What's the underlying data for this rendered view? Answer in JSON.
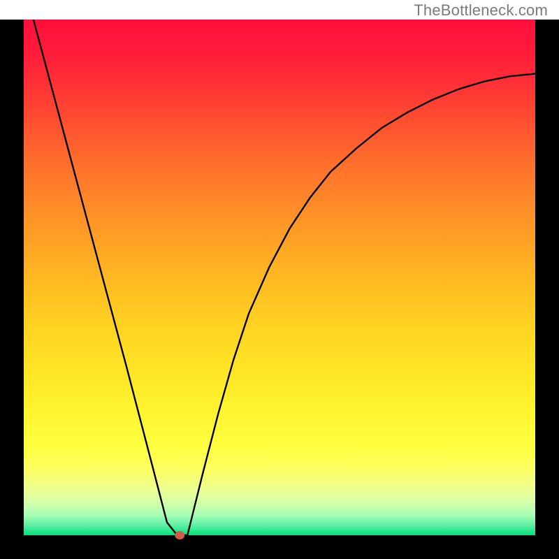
{
  "attribution": "TheBottleneck.com",
  "chart_data": {
    "type": "line",
    "title": "",
    "xlabel": "",
    "ylabel": "",
    "xlim": [
      0,
      1
    ],
    "ylim": [
      0,
      1
    ],
    "x": [
      0.0,
      0.05,
      0.1,
      0.15,
      0.2,
      0.25,
      0.28,
      0.3,
      0.31,
      0.32,
      0.33,
      0.35,
      0.38,
      0.41,
      0.44,
      0.48,
      0.52,
      0.56,
      0.6,
      0.65,
      0.7,
      0.75,
      0.8,
      0.85,
      0.9,
      0.95,
      1.0
    ],
    "values": [
      1.07,
      0.885,
      0.7,
      0.515,
      0.33,
      0.14,
      0.025,
      0.0,
      0.0,
      0.0,
      0.04,
      0.12,
      0.235,
      0.34,
      0.43,
      0.52,
      0.595,
      0.655,
      0.705,
      0.75,
      0.79,
      0.82,
      0.845,
      0.865,
      0.88,
      0.89,
      0.895
    ],
    "marker": {
      "x": 0.305,
      "y": 0.0
    },
    "background_gradient": {
      "stops": [
        {
          "offset": 0.0,
          "color": "#ff0e3c"
        },
        {
          "offset": 0.06,
          "color": "#ff1b3a"
        },
        {
          "offset": 0.12,
          "color": "#ff2f36"
        },
        {
          "offset": 0.2,
          "color": "#ff5030"
        },
        {
          "offset": 0.28,
          "color": "#ff6f2c"
        },
        {
          "offset": 0.36,
          "color": "#ff8b28"
        },
        {
          "offset": 0.44,
          "color": "#ffa524"
        },
        {
          "offset": 0.52,
          "color": "#ffbe22"
        },
        {
          "offset": 0.6,
          "color": "#ffd422"
        },
        {
          "offset": 0.68,
          "color": "#ffe526"
        },
        {
          "offset": 0.76,
          "color": "#fff430"
        },
        {
          "offset": 0.83,
          "color": "#ffff40"
        },
        {
          "offset": 0.87,
          "color": "#fcff60"
        },
        {
          "offset": 0.905,
          "color": "#f0ff8a"
        },
        {
          "offset": 0.935,
          "color": "#d6ffa8"
        },
        {
          "offset": 0.96,
          "color": "#a8ffb4"
        },
        {
          "offset": 0.98,
          "color": "#60f0a8"
        },
        {
          "offset": 1.0,
          "color": "#00e477"
        }
      ]
    },
    "plot_frame": {
      "stroke": "#000000",
      "stroke_width": 40,
      "background_outside": "#000000"
    },
    "annotations": []
  }
}
